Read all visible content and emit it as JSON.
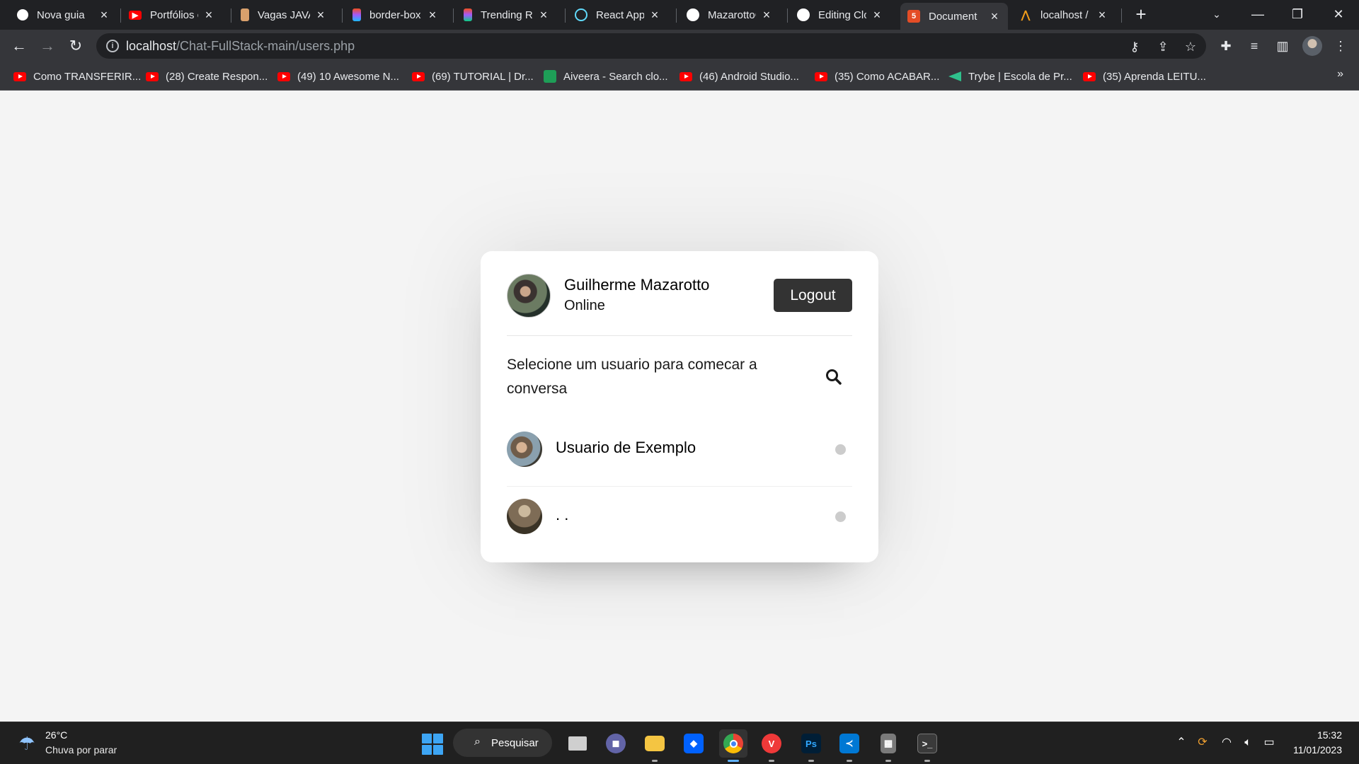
{
  "browser": {
    "tabs": [
      {
        "title": "Nova guia",
        "icon": "chrome-icon",
        "color": "#ffffff"
      },
      {
        "title": "Portfólios c",
        "icon": "youtube-icon",
        "color": "#ff0000"
      },
      {
        "title": "Vagas JAVA",
        "icon": "hammer-icon",
        "color": "#d9a06c"
      },
      {
        "title": "border-box",
        "icon": "figma-icon",
        "color": "#f24e1e"
      },
      {
        "title": "Trending Re",
        "icon": "figma-icon",
        "color": "#a259ff"
      },
      {
        "title": "React App",
        "icon": "react-icon",
        "color": "#61dafb"
      },
      {
        "title": "MazarottoC",
        "icon": "github-icon",
        "color": "#ffffff"
      },
      {
        "title": "Editing Clon",
        "icon": "github-icon",
        "color": "#ffffff"
      },
      {
        "title": "Document",
        "icon": "html5-icon",
        "color": "#e44d26",
        "active": true
      },
      {
        "title": "localhost /",
        "icon": "phpmyadmin-icon",
        "color": "#f59e1a"
      }
    ],
    "url_host": "localhost",
    "url_path": "/Chat-FullStack-main/users.php",
    "bookmarks": [
      {
        "label": "Como TRANSFERIR...",
        "icon": "youtube"
      },
      {
        "label": "(28) Create Respon...",
        "icon": "youtube"
      },
      {
        "label": "(49) 10 Awesome N...",
        "icon": "youtube"
      },
      {
        "label": "(69) TUTORIAL | Dr...",
        "icon": "youtube"
      },
      {
        "label": "Aiveera - Search clo...",
        "icon": "aiveera"
      },
      {
        "label": "(46) Android Studio...",
        "icon": "youtube"
      },
      {
        "label": "(35) Como ACABAR...",
        "icon": "youtube"
      },
      {
        "label": "Trybe | Escola de Pr...",
        "icon": "trybe"
      },
      {
        "label": "(35) Aprenda LEITU...",
        "icon": "youtube"
      }
    ]
  },
  "chat": {
    "current_user": {
      "name": "Guilherme Mazarotto",
      "status": "Online"
    },
    "logout_label": "Logout",
    "search_prompt": "Selecione um usuario para comecar a conversa",
    "users": [
      {
        "name": "Usuario de Exemplo"
      },
      {
        "name": ". ."
      }
    ]
  },
  "taskbar": {
    "weather_temp": "26°C",
    "weather_desc": "Chuva por parar",
    "search_label": "Pesquisar",
    "time": "15:32",
    "date": "11/01/2023"
  }
}
